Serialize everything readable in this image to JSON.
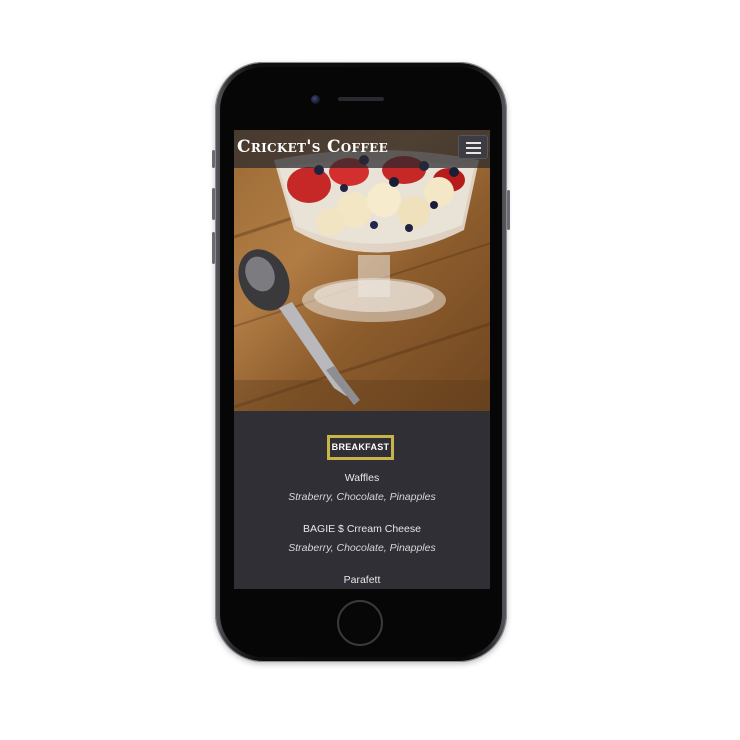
{
  "site": {
    "brand": "Cricket's Coffee"
  },
  "navbar": {
    "menu_icon": "hamburger-menu-icon"
  },
  "menu": {
    "section_label": "BREAKFAST",
    "items": [
      {
        "name": "Waffles",
        "description": "Straberry, Chocolate, Pinapples"
      },
      {
        "name": "BAGIE $ Crream Cheese",
        "description": "Straberry, Chocolate, Pinapples"
      },
      {
        "name": "Parafett",
        "description": ""
      }
    ]
  },
  "colors": {
    "accent_border": "#c9b44a",
    "screen_background": "#2f2f35",
    "navbar_background": "#28282d"
  }
}
